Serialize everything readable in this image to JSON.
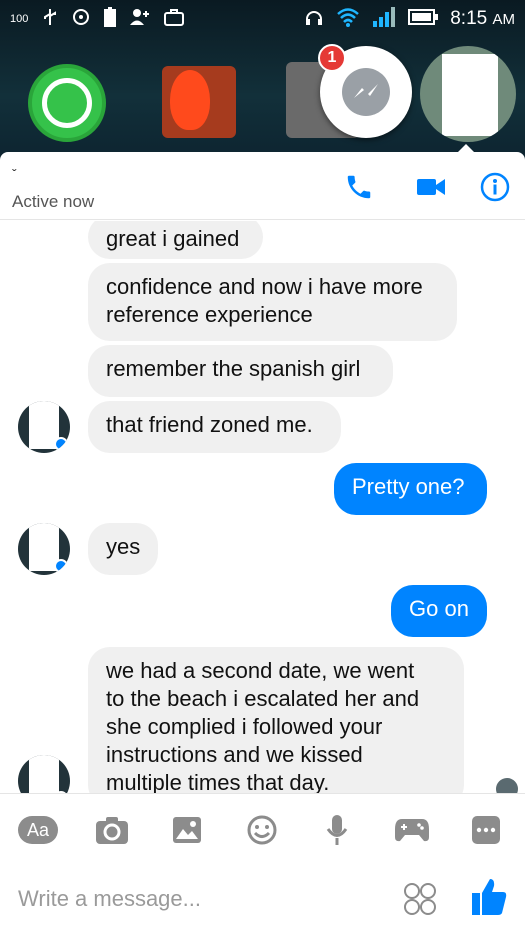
{
  "status_bar": {
    "battery_percent": "100",
    "time": "8:15",
    "ampm": "AM"
  },
  "home": {
    "chathead_badge": "1"
  },
  "header": {
    "contact_name": "ˇ",
    "status": "Active now"
  },
  "messages": [
    {
      "from": "them",
      "text": "great i gained"
    },
    {
      "from": "them",
      "text": "confidence and now i have more\nreference experience"
    },
    {
      "from": "them",
      "text": "remember the spanish girl"
    },
    {
      "from": "them",
      "text": "that friend zoned me."
    },
    {
      "from": "me",
      "text": "Pretty one?"
    },
    {
      "from": "them",
      "text": "yes"
    },
    {
      "from": "me",
      "text": "Go on"
    },
    {
      "from": "them",
      "text": "we had a second date, we went\nto the beach i escalated her and\nshe complied i followed your\ninstructions and we kissed\nmultiple times that day."
    }
  ],
  "toolbar": {
    "aa_label": "Aa"
  },
  "composer": {
    "placeholder": "Write a message..."
  },
  "colors": {
    "accent": "#0084ff",
    "incoming_bubble": "#f0f0f0",
    "background": "#ffffff"
  },
  "icons": [
    "usb-icon",
    "wifi-icon",
    "battery-icon",
    "add-user-icon",
    "briefcase-icon",
    "headset-icon",
    "signal-icon",
    "phone-icon",
    "video-icon",
    "info-icon",
    "camera-icon",
    "image-icon",
    "emoji-icon",
    "mic-icon",
    "game-icon",
    "more-icon",
    "sticker-icon",
    "thumbs-up-icon"
  ]
}
